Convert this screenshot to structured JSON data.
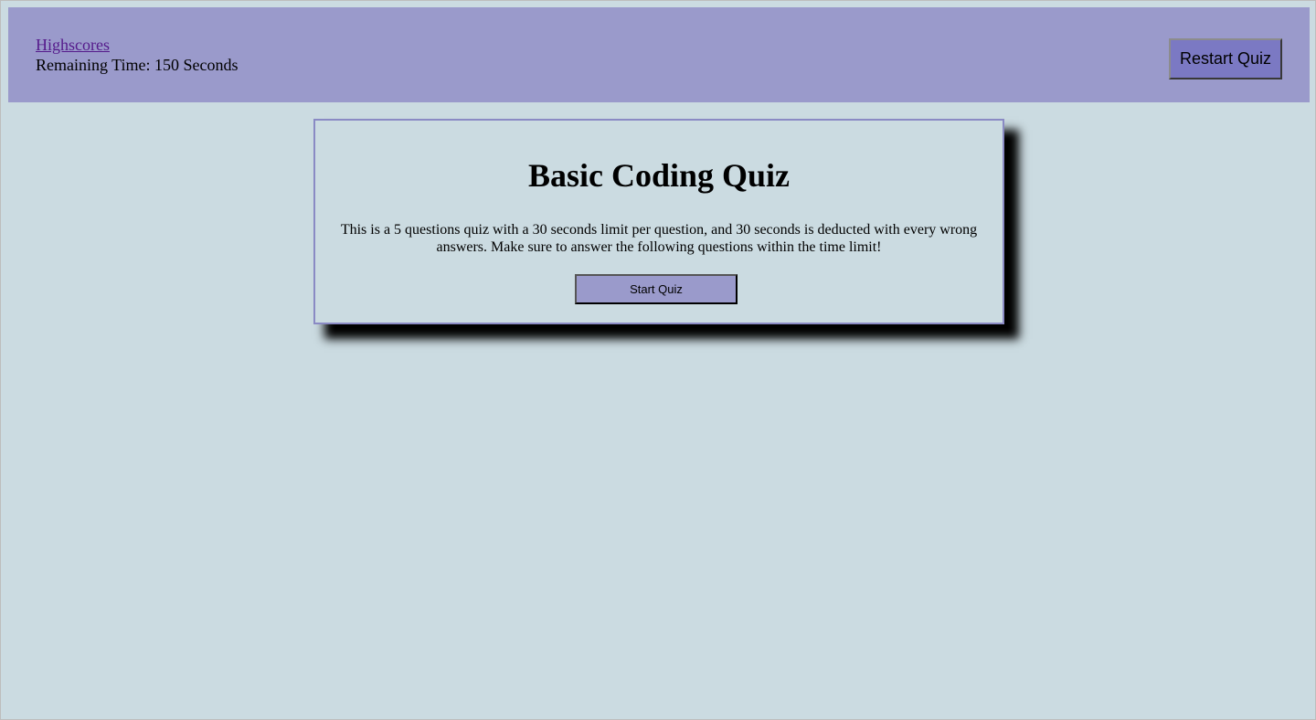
{
  "header": {
    "highscores_link": "Highscores",
    "remaining_time": "Remaining Time: 150 Seconds",
    "restart_label": "Restart Quiz"
  },
  "card": {
    "title": "Basic Coding Quiz",
    "description": "This is a 5 questions quiz with a 30 seconds limit per question, and 30 seconds is deducted with every wrong answers. Make sure to answer the following questions within the time limit!",
    "start_label": "Start Quiz"
  },
  "colors": {
    "page_background": "#cbdbe1",
    "header_background": "#9a9acb",
    "restart_button": "#7b79c3",
    "start_button": "#9a9acb",
    "card_border": "#8a8ac4",
    "link": "#551a8b"
  }
}
